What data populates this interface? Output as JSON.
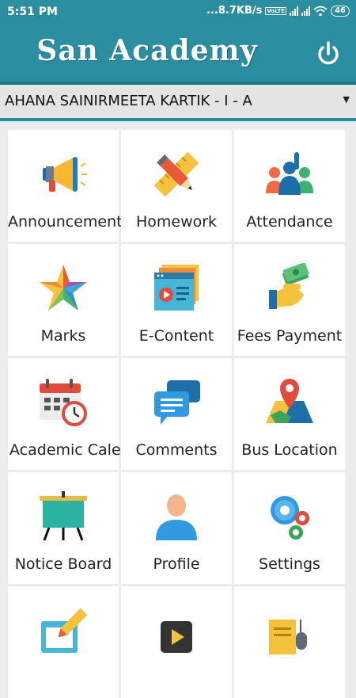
{
  "status_bar": {
    "time": "5:51 PM",
    "network_speed": "...8.7KB/s",
    "volte": "VoLTE",
    "battery": "46"
  },
  "app_bar": {
    "title": "San Academy",
    "power_icon": "power-icon"
  },
  "student_select": {
    "selected": "AHANA SAINIRMEETA KARTIK - I - A"
  },
  "menu": {
    "items": [
      {
        "label": "Announcement",
        "icon": "megaphone-icon"
      },
      {
        "label": "Homework",
        "icon": "pencil-ruler-icon"
      },
      {
        "label": "Attendance",
        "icon": "raised-hand-group-icon"
      },
      {
        "label": "Marks",
        "icon": "star-icon"
      },
      {
        "label": "E-Content",
        "icon": "video-window-icon"
      },
      {
        "label": "Fees Payment",
        "icon": "hand-money-icon"
      },
      {
        "label": "Academic Calendar",
        "icon": "calendar-clock-icon"
      },
      {
        "label": "Comments",
        "icon": "chat-bubbles-icon"
      },
      {
        "label": "Bus Location",
        "icon": "map-pin-icon"
      },
      {
        "label": "Notice Board",
        "icon": "board-icon"
      },
      {
        "label": "Profile",
        "icon": "user-icon"
      },
      {
        "label": "Settings",
        "icon": "gears-icon"
      },
      {
        "label": "",
        "icon": "edit-icon"
      },
      {
        "label": "",
        "icon": "media-player-icon"
      },
      {
        "label": "",
        "icon": "document-mouse-icon"
      }
    ]
  },
  "colors": {
    "primary": "#2a8ea0",
    "dark_stripe": "#217686",
    "background": "#ececec",
    "tile": "#ffffff"
  }
}
